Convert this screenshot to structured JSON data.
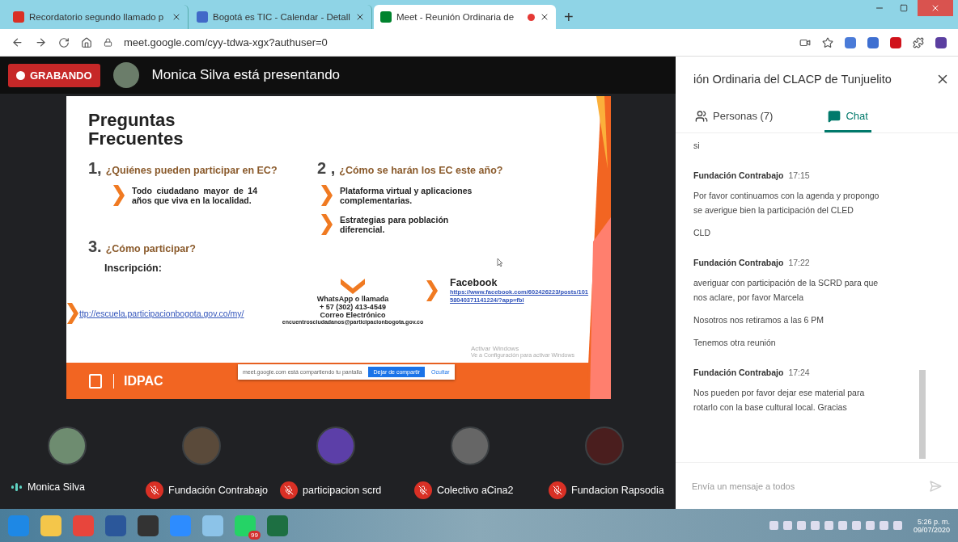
{
  "browser": {
    "tabs": [
      {
        "kind": "gmail",
        "title": "Recordatorio segundo llamado p",
        "selected": false,
        "recording": false
      },
      {
        "kind": "calendar",
        "title": "Bogotá es TIC - Calendar - Detall",
        "selected": false,
        "recording": false
      },
      {
        "kind": "meet",
        "title": "Meet - Reunión Ordinaria de",
        "selected": true,
        "recording": true
      }
    ],
    "new_tab": "+",
    "address": "meet.google.com/cyy-tdwa-xgx?authuser=0"
  },
  "meeting": {
    "recording_label": "GRABANDO",
    "presenter": "Monica Silva está presentando"
  },
  "slide": {
    "title": "Preguntas Frecuentes",
    "q1": {
      "number": "1,",
      "question": "¿Quiénes pueden participar en EC?",
      "answer": "Todo ciudadano mayor de 14 años que viva en la localidad."
    },
    "q2": {
      "number": "2 ,",
      "question_bold": "¿Cómo",
      "question_rest": "se harán los EC este año?",
      "answers": [
        "Plataforma virtual y aplicaciones complementarias.",
        "Estrategias para población diferencial."
      ]
    },
    "q3": {
      "number": "3.",
      "question": "¿Cómo participar?",
      "label": "Inscripción:"
    },
    "link": "ttp://escuela.participacionbogota.gov.co/my/",
    "contact": [
      "WhatsApp o llamada",
      "+ 57 (302) 413-4549",
      "Correo Electrónico",
      "encuentrosciudadanos@participacionbogota.gov.co"
    ],
    "facebook": {
      "label": "Facebook",
      "url": "https://www.facebook.com/602426223/posts/10158040371141224/?app=fbl"
    },
    "brand": "IDPAC",
    "share_bar": {
      "text": "meet.google.com está compartiendo tu pantalla",
      "stop": "Dejar de compartir",
      "hide": "Ocultar"
    },
    "os_notice": [
      "Activar Windows",
      "Ve a Configuración para activar Windows"
    ]
  },
  "participants": [
    {
      "name": "Monica Silva",
      "muted": false
    },
    {
      "name": "Fundación Contrabajo",
      "muted": true
    },
    {
      "name": "participacion scrd",
      "muted": true
    },
    {
      "name": "Colectivo aCina2",
      "muted": true
    },
    {
      "name": "Fundacion Rapsodia",
      "muted": true
    }
  ],
  "panel": {
    "title": "ión Ordinaria del CLACP de Tunjuelito",
    "tabs": [
      {
        "kind": "people",
        "label": "Personas (7)",
        "selected": false
      },
      {
        "kind": "chat",
        "label": "Chat",
        "selected": true
      }
    ],
    "messages": [
      {
        "lines": [
          "si"
        ]
      },
      {
        "sender": "Fundación Contrabajo",
        "time": "17:15",
        "lines": [
          "Por favor continuamos con la agenda y propongo se averigue bien la participación del CLED",
          "CLD"
        ]
      },
      {
        "sender": "Fundación Contrabajo",
        "time": "17:22",
        "lines": [
          "averiguar con participación de la SCRD para que nos aclare, por favor Marcela",
          "Nosotros nos retiramos a las 6 PM",
          "Tenemos otra reunión"
        ]
      },
      {
        "sender": "Fundación Contrabajo",
        "time": "17:24",
        "lines": [
          "Nos pueden por favor dejar ese material para rotarlo con la base cultural local. Gracias"
        ]
      }
    ],
    "input_placeholder": "Envía un mensaje a todos"
  },
  "taskbar": {
    "whatsapp_badge": "99",
    "time": "5:26 p. m.",
    "date": "09/07/2020"
  }
}
